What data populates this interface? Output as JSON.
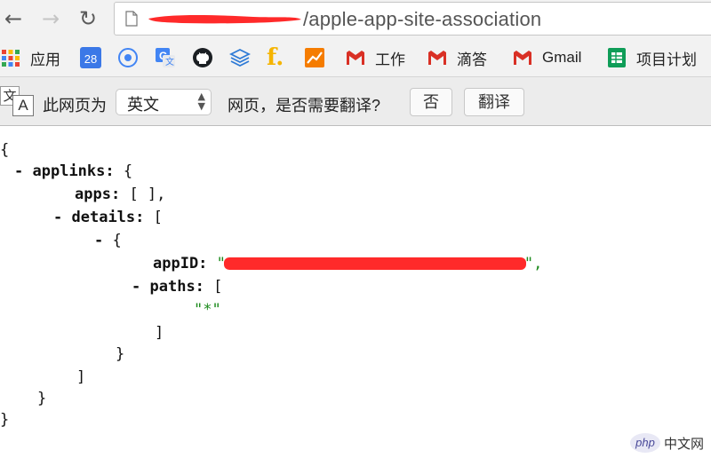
{
  "nav": {
    "back_icon": "arrow-left-icon",
    "forward_icon": "arrow-right-icon",
    "reload_icon": "reload-icon"
  },
  "address_bar": {
    "url_visible": "/apple-app-site-association",
    "page_icon": "document-icon"
  },
  "bookmarks": [
    {
      "label": "应用",
      "icon": "apps-grid-icon"
    },
    {
      "label": "",
      "icon": "calendar-icon",
      "badge": "28"
    },
    {
      "label": "",
      "icon": "chrome-icon"
    },
    {
      "label": "",
      "icon": "google-translate-icon"
    },
    {
      "label": "",
      "icon": "github-icon"
    },
    {
      "label": "",
      "icon": "layers-icon"
    },
    {
      "label": "",
      "icon": "f-icon",
      "glyph": "f."
    },
    {
      "label": "",
      "icon": "chart-icon"
    },
    {
      "label": "工作",
      "icon": "gmail-icon"
    },
    {
      "label": "滴答",
      "icon": "gmail-icon"
    },
    {
      "label": "Gmail",
      "icon": "gmail-icon"
    },
    {
      "label": "项目计划",
      "icon": "sheets-icon"
    }
  ],
  "translate_bar": {
    "icon": "translate-icon",
    "icon_glyph_top": "文",
    "icon_glyph_bottom": "A",
    "prefix": "此网页为",
    "language": "英文",
    "question": "网页，是否需要翻译?",
    "no_button": "否",
    "translate_button": "翻译"
  },
  "json_view": {
    "open_brace": "{",
    "collapse": "-",
    "applinks_key": "applinks:",
    "applinks_open": "{",
    "apps_key": "apps:",
    "apps_value": "[ ],",
    "details_key": "details:",
    "details_open": "[",
    "item_open": "{",
    "appid_key": "appID:",
    "appid_quote_open": "\"",
    "appid_quote_close": "\",",
    "paths_key": "paths:",
    "paths_open": "[",
    "path_value": "\"*\"",
    "paths_close": "]",
    "item_close": "}",
    "details_close": "]",
    "applinks_close": "}",
    "close_brace": "}"
  },
  "watermark": {
    "php": "php",
    "site": "中文网"
  },
  "colors": {
    "string_green": "#1b8a1b",
    "redaction_red": "#ff2a2a",
    "gmail_red": "#d93025"
  }
}
